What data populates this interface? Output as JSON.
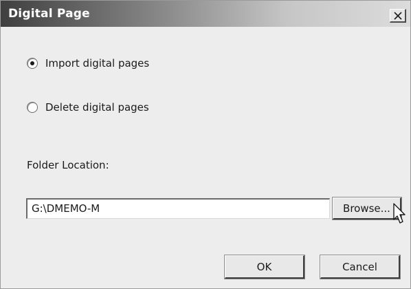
{
  "dialog": {
    "title": "Digital Page",
    "close_icon": "close-icon"
  },
  "options": {
    "import_label": "Import digital pages",
    "import_selected": true,
    "delete_label": "Delete digital pages",
    "delete_selected": false
  },
  "folder": {
    "label": "Folder Location:",
    "path_value": "G:\\DMEMO-M",
    "browse_label": "Browse..."
  },
  "buttons": {
    "ok_label": "OK",
    "cancel_label": "Cancel"
  },
  "colors": {
    "titlebar_dark": "#3f3f3f",
    "dialog_bg": "#ededed"
  }
}
